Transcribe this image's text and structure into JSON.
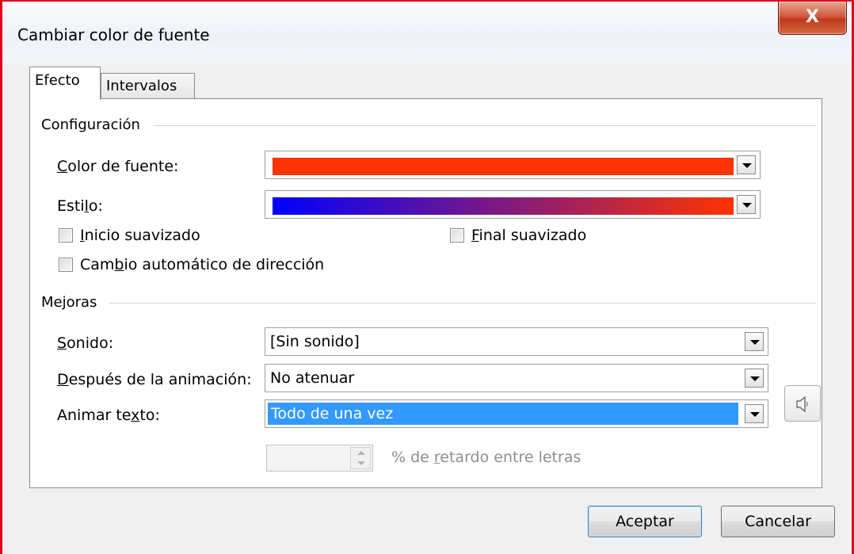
{
  "window": {
    "title": "Cambiar color de fuente",
    "close_label": "X"
  },
  "tabs": [
    {
      "label": "Efecto",
      "active": true
    },
    {
      "label": "Intervalos",
      "active": false
    }
  ],
  "configuracion": {
    "heading": "Configuración",
    "color_fuente": {
      "label_pre": "",
      "label_u": "C",
      "label_post": "olor de fuente:",
      "color": "#ff3300"
    },
    "estilo": {
      "label_pre": "Esti",
      "label_u": "l",
      "label_post": "o:",
      "gradient_from": "#0000ff",
      "gradient_to": "#ff3300"
    },
    "inicio_suavizado": {
      "label_u": "I",
      "label_post": "nicio suavizado",
      "checked": false
    },
    "final_suavizado": {
      "label_u": "F",
      "label_post": "inal suavizado",
      "checked": false
    },
    "cambio_direccion": {
      "label_pre": "Cam",
      "label_u": "b",
      "label_post": "io automático de dirección",
      "checked": false
    }
  },
  "mejoras": {
    "heading": "Mejoras",
    "sonido": {
      "label_u": "S",
      "label_post": "onido:",
      "value": "[Sin sonido]"
    },
    "despues": {
      "label_u": "D",
      "label_post": "espués de la animación:",
      "value": "No atenuar"
    },
    "animar": {
      "label_pre": "Animar te",
      "label_u": "x",
      "label_post": "to:",
      "value": "Todo de una vez"
    },
    "retardo": {
      "value": "",
      "label_pre": "% de ",
      "label_u": "r",
      "label_post": "etardo entre letras"
    }
  },
  "buttons": {
    "ok": "Aceptar",
    "cancel": "Cancelar"
  },
  "icons": {
    "close": "close-icon",
    "sound": "speaker-icon",
    "dropdown": "chevron-down-icon"
  }
}
